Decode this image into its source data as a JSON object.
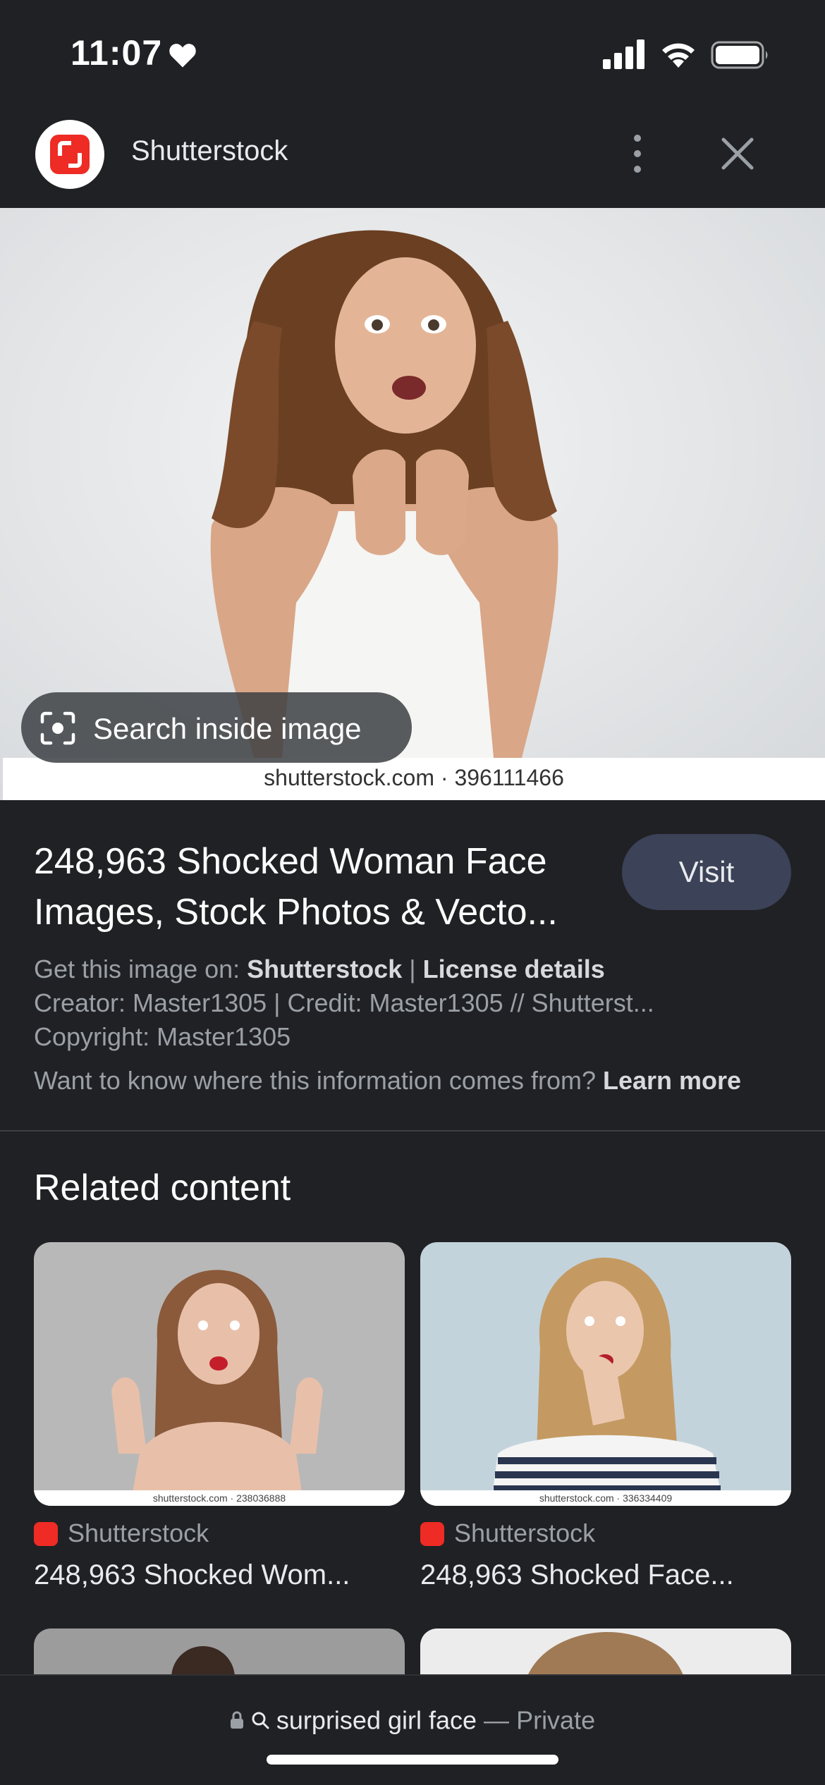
{
  "status_bar": {
    "time": "11:07"
  },
  "header": {
    "site_name": "Shutterstock"
  },
  "hero": {
    "watermark": "shutterstock.com · 396111466",
    "search_inside_label": "Search inside image"
  },
  "result": {
    "title": "248,963 Shocked Woman Face Images, Stock Photos & Vecto...",
    "visit_label": "Visit",
    "get_image_prefix": "Get this image on:",
    "get_image_source": "Shutterstock",
    "separator": "|",
    "license_details": "License details",
    "creator_line": "Creator: Master1305 | Credit: Master1305 // Shutterst...",
    "copyright_line": "Copyright: Master1305",
    "info_question": "Want to know where this information comes from?",
    "learn_more": "Learn more"
  },
  "related": {
    "heading": "Related content",
    "cards": [
      {
        "watermark": "shutterstock.com · 238036888",
        "source": "Shutterstock",
        "title": "248,963 Shocked Wom..."
      },
      {
        "watermark": "shutterstock.com · 336334409",
        "source": "Shutterstock",
        "title": "248,963 Shocked Face..."
      }
    ]
  },
  "bottom_bar": {
    "query": "surprised girl face",
    "dash": "—",
    "mode": "Private"
  },
  "colors": {
    "background": "#202124",
    "brand_red": "#ee2b24",
    "visit_button": "#3c4257"
  },
  "icons": [
    "heart-icon",
    "signal-icon",
    "wifi-icon",
    "battery-icon",
    "more-vert-icon",
    "close-icon",
    "lens-icon",
    "lock-icon",
    "search-icon"
  ]
}
